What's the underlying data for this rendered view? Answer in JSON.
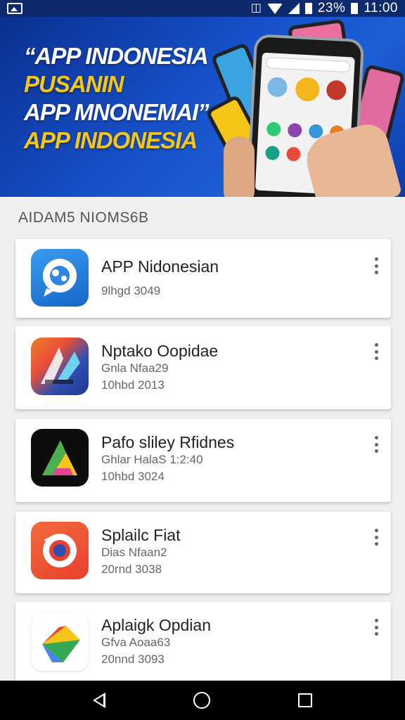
{
  "status_bar": {
    "battery": "23%",
    "time": "11:00",
    "icons": [
      "image-icon",
      "vibrate-icon",
      "wifi-icon",
      "signal-icon",
      "battery-icon"
    ]
  },
  "banner": {
    "lines": [
      {
        "text": "“APP INDONESIA",
        "color": "#ffffff"
      },
      {
        "text": "PUSANIN",
        "color": "#f5c518"
      },
      {
        "text": "APP MNONEMAI”",
        "color": "#ffffff"
      },
      {
        "text": "APP INDONESIA",
        "color": "#f5c518"
      }
    ]
  },
  "section": {
    "title": "AIDAM5 NIOMS6B"
  },
  "apps": [
    {
      "name": "APP Nidonesian",
      "meta1": "9lhgd 3049",
      "meta2": "",
      "icon": "chat-bubble-icon"
    },
    {
      "name": "Nptako Oopidae",
      "meta1": "Gnla Nfaa29",
      "meta2": "10hbd 2013",
      "icon": "logo-icon"
    },
    {
      "name": "Pafo sliley Rfidnes",
      "meta1": "Ghlar HalaS 1:2:40",
      "meta2": "10hbd 3024",
      "icon": "triangle-logo-icon"
    },
    {
      "name": "Splailc Fiat",
      "meta1": "Dias Nfaan2",
      "meta2": "20rnd 3038",
      "icon": "camera-icon"
    },
    {
      "name": "Aplaigk Opdian",
      "meta1": "Gfva Aoaa63",
      "meta2": "20nnd 3093",
      "icon": "play-store-icon"
    }
  ],
  "nav_bar": {
    "icons": [
      "back-icon",
      "home-icon",
      "recents-icon"
    ]
  }
}
